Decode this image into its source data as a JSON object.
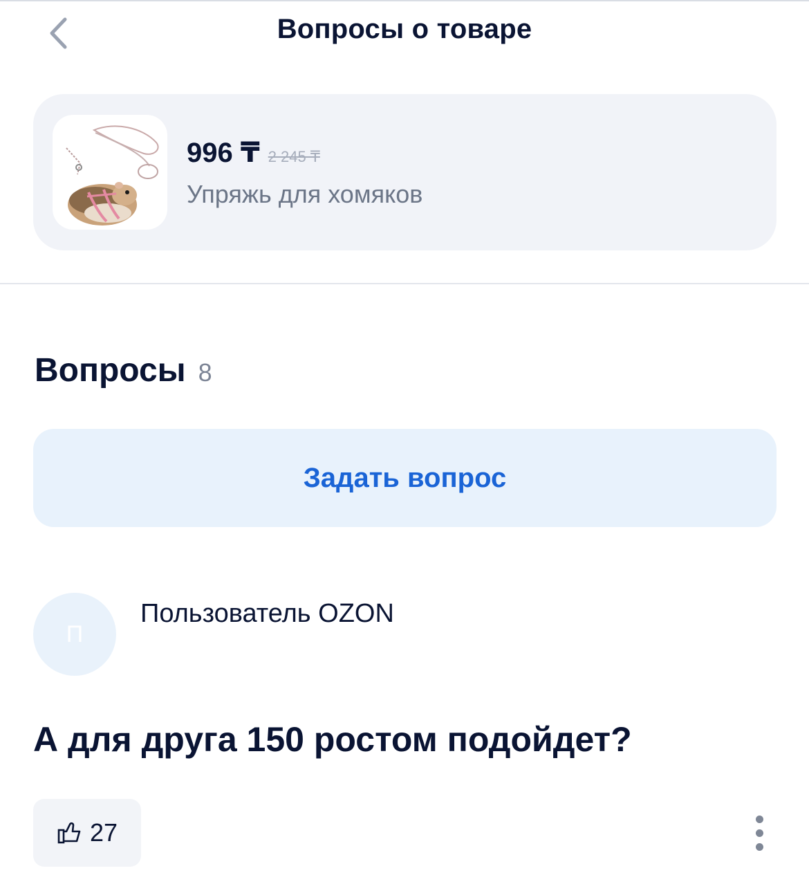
{
  "header": {
    "title": "Вопросы о товаре"
  },
  "product": {
    "price_current": "996 ₸",
    "price_old": "2 245 ₸",
    "name": "Упряжь для хомяков",
    "image_icon": "hamster-harness-photo"
  },
  "questions": {
    "title": "Вопросы",
    "count": "8",
    "ask_label": "Задать вопрос",
    "items": [
      {
        "avatar_letter": "П",
        "author": "Пользователь OZON",
        "text": "А для друга  150 ростом подойдет?",
        "likes": "27"
      }
    ]
  },
  "colors": {
    "accent": "#1a64d6",
    "ask_bg": "#e8f2fc",
    "card_bg": "#f1f3f8",
    "text_primary": "#0a1433",
    "text_secondary": "#6b7587"
  }
}
